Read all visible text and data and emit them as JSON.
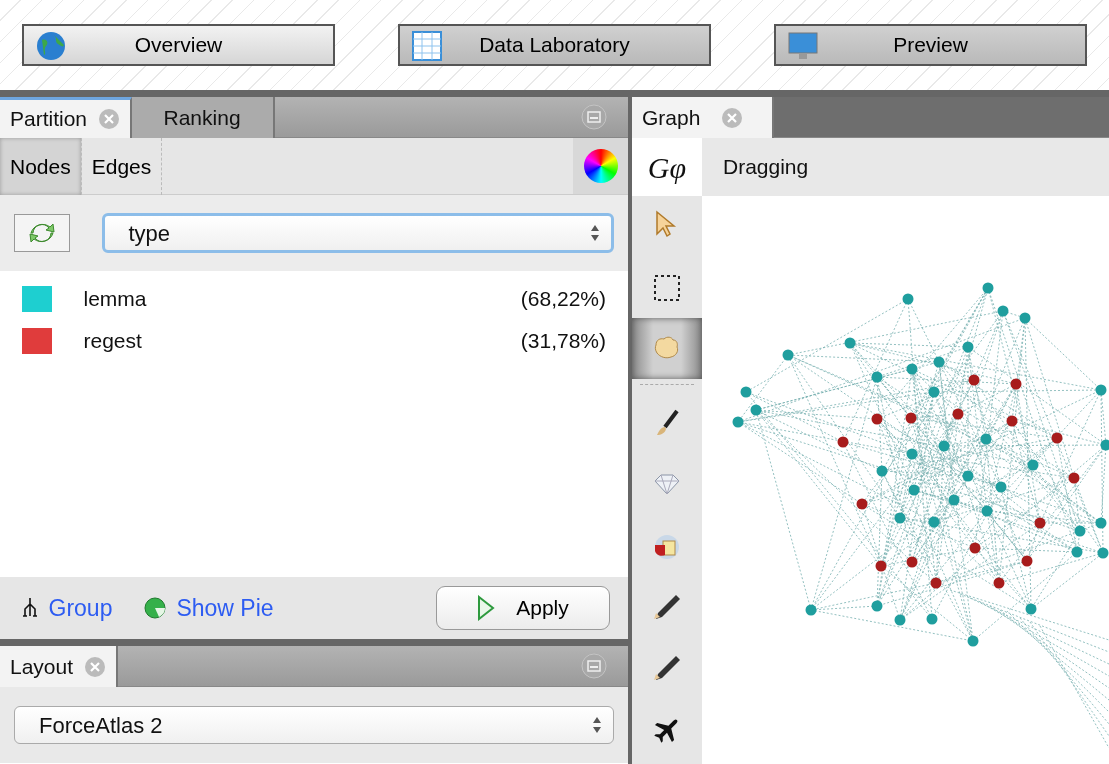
{
  "perspectives": [
    {
      "label": "Overview",
      "kind": "globe"
    },
    {
      "label": "Data Laboratory",
      "kind": "table"
    },
    {
      "label": "Preview",
      "kind": "monitor"
    }
  ],
  "partition_panel": {
    "tabs": [
      {
        "label": "Partition",
        "selected": true,
        "closable": true
      },
      {
        "label": "Ranking",
        "selected": false,
        "closable": false
      }
    ],
    "subtabs": [
      {
        "label": "Nodes",
        "selected": true
      },
      {
        "label": "Edges",
        "selected": false
      }
    ],
    "attribute_select": {
      "value": "type"
    },
    "partitions": [
      {
        "label": "lemma",
        "percent": "(68,22%)",
        "color": "#1ecfd0"
      },
      {
        "label": "regest",
        "percent": "(31,78%)",
        "color": "#e03c3c"
      }
    ],
    "links": [
      {
        "label": "Group",
        "kind": "group"
      },
      {
        "label": "Show Pie",
        "kind": "pie"
      }
    ],
    "apply_button": "Apply"
  },
  "layout_panel": {
    "tab": {
      "label": "Layout",
      "closable": true
    },
    "algorithm_select": {
      "value": "ForceAtlas 2"
    }
  },
  "graph_panel": {
    "tab": {
      "label": "Graph",
      "closable": true
    },
    "logo": "Gφ",
    "tool_label": "Dragging",
    "tools": [
      {
        "kind": "pointer",
        "selected": false
      },
      {
        "kind": "rect-select",
        "selected": false
      },
      {
        "kind": "hand",
        "selected": true
      },
      {
        "kind": "separator"
      },
      {
        "kind": "brush",
        "selected": false
      },
      {
        "kind": "diamond",
        "selected": false
      },
      {
        "kind": "bucket",
        "selected": false
      },
      {
        "kind": "pencil",
        "selected": false
      },
      {
        "kind": "pencil",
        "selected": false
      },
      {
        "kind": "plane",
        "selected": false
      }
    ]
  }
}
